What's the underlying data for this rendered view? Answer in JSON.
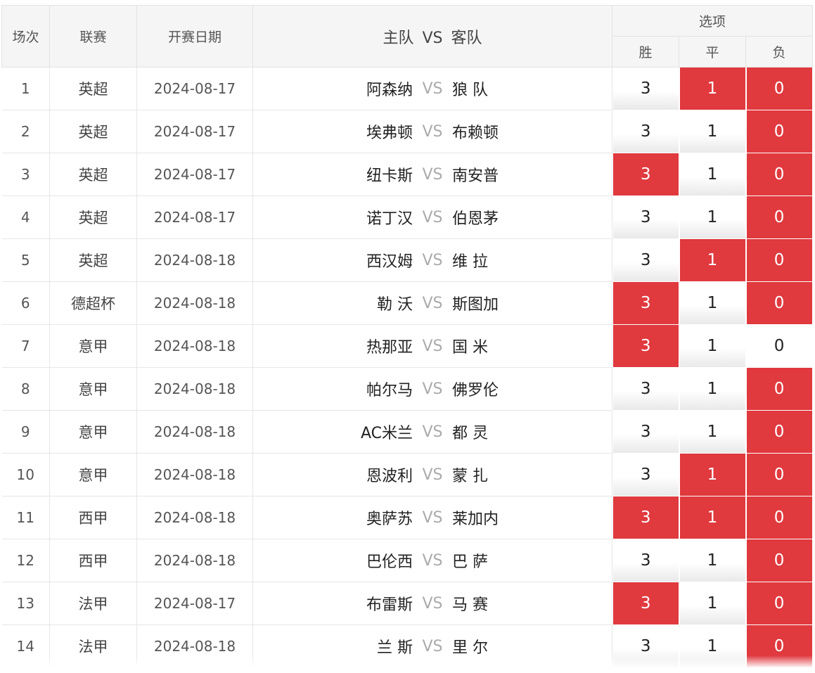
{
  "header": {
    "num": "场次",
    "league": "联赛",
    "date": "开赛日期",
    "home": "主队",
    "vs": "VS",
    "away": "客队",
    "options": "选项",
    "win": "胜",
    "draw": "平",
    "loss": "负"
  },
  "rows": [
    {
      "num": "1",
      "league": "英超",
      "date": "2024-08-17",
      "home": "阿森纳",
      "vs": "VS",
      "away": "狼 队",
      "win": "3",
      "draw": "1",
      "loss": "0",
      "sel": [
        false,
        true,
        true
      ]
    },
    {
      "num": "2",
      "league": "英超",
      "date": "2024-08-17",
      "home": "埃弗顿",
      "vs": "VS",
      "away": "布赖顿",
      "win": "3",
      "draw": "1",
      "loss": "0",
      "sel": [
        false,
        false,
        true
      ]
    },
    {
      "num": "3",
      "league": "英超",
      "date": "2024-08-17",
      "home": "纽卡斯",
      "vs": "VS",
      "away": "南安普",
      "win": "3",
      "draw": "1",
      "loss": "0",
      "sel": [
        true,
        false,
        true
      ]
    },
    {
      "num": "4",
      "league": "英超",
      "date": "2024-08-17",
      "home": "诺丁汉",
      "vs": "VS",
      "away": "伯恩茅",
      "win": "3",
      "draw": "1",
      "loss": "0",
      "sel": [
        false,
        false,
        true
      ]
    },
    {
      "num": "5",
      "league": "英超",
      "date": "2024-08-18",
      "home": "西汉姆",
      "vs": "VS",
      "away": "维 拉",
      "win": "3",
      "draw": "1",
      "loss": "0",
      "sel": [
        false,
        true,
        true
      ]
    },
    {
      "num": "6",
      "league": "德超杯",
      "date": "2024-08-18",
      "home": "勒 沃",
      "vs": "VS",
      "away": "斯图加",
      "win": "3",
      "draw": "1",
      "loss": "0",
      "sel": [
        true,
        false,
        true
      ]
    },
    {
      "num": "7",
      "league": "意甲",
      "date": "2024-08-18",
      "home": "热那亚",
      "vs": "VS",
      "away": "国 米",
      "win": "3",
      "draw": "1",
      "loss": "0",
      "sel": [
        true,
        false,
        false
      ]
    },
    {
      "num": "8",
      "league": "意甲",
      "date": "2024-08-18",
      "home": "帕尔马",
      "vs": "VS",
      "away": "佛罗伦",
      "win": "3",
      "draw": "1",
      "loss": "0",
      "sel": [
        false,
        false,
        true
      ]
    },
    {
      "num": "9",
      "league": "意甲",
      "date": "2024-08-18",
      "home": "AC米兰",
      "vs": "VS",
      "away": "都 灵",
      "win": "3",
      "draw": "1",
      "loss": "0",
      "sel": [
        false,
        false,
        true
      ]
    },
    {
      "num": "10",
      "league": "意甲",
      "date": "2024-08-18",
      "home": "恩波利",
      "vs": "VS",
      "away": "蒙 扎",
      "win": "3",
      "draw": "1",
      "loss": "0",
      "sel": [
        false,
        true,
        true
      ]
    },
    {
      "num": "11",
      "league": "西甲",
      "date": "2024-08-18",
      "home": "奥萨苏",
      "vs": "VS",
      "away": "莱加内",
      "win": "3",
      "draw": "1",
      "loss": "0",
      "sel": [
        true,
        true,
        true
      ]
    },
    {
      "num": "12",
      "league": "西甲",
      "date": "2024-08-18",
      "home": "巴伦西",
      "vs": "VS",
      "away": "巴 萨",
      "win": "3",
      "draw": "1",
      "loss": "0",
      "sel": [
        false,
        false,
        true
      ]
    },
    {
      "num": "13",
      "league": "法甲",
      "date": "2024-08-17",
      "home": "布雷斯",
      "vs": "VS",
      "away": "马 赛",
      "win": "3",
      "draw": "1",
      "loss": "0",
      "sel": [
        true,
        false,
        true
      ]
    },
    {
      "num": "14",
      "league": "法甲",
      "date": "2024-08-18",
      "home": "兰 斯",
      "vs": "VS",
      "away": "里 尔",
      "win": "3",
      "draw": "1",
      "loss": "0",
      "sel": [
        false,
        false,
        true
      ]
    }
  ],
  "colors": {
    "selected": "#e0393e",
    "header_bg": "#f5f5f5"
  }
}
